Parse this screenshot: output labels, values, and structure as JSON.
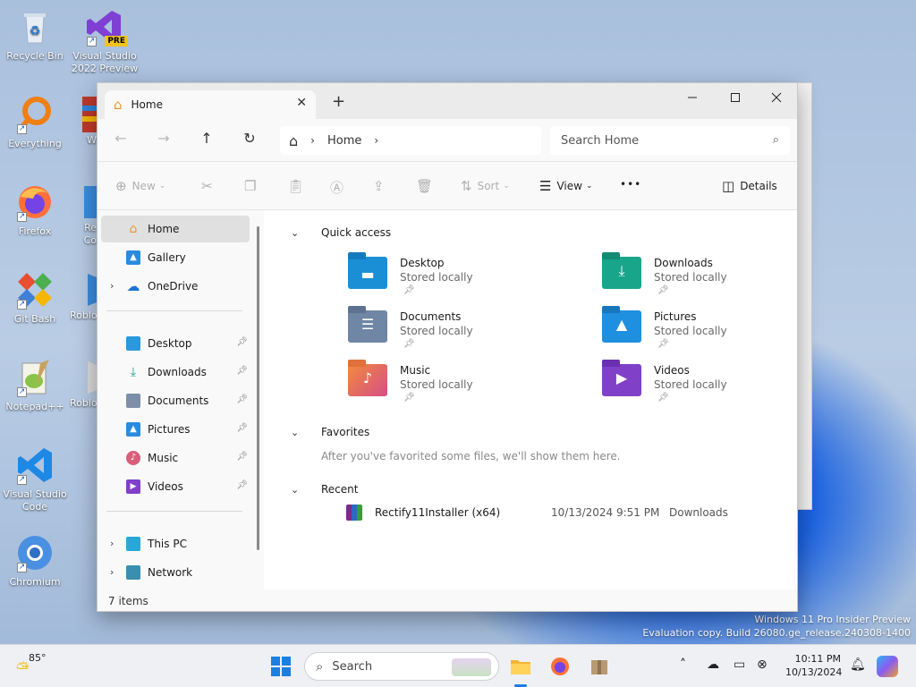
{
  "desktop": {
    "icons": [
      {
        "label": "Recycle Bin"
      },
      {
        "label": "Visual Studio 2022 Preview",
        "badge": "PRE"
      },
      {
        "label": "Everything"
      },
      {
        "label": "W"
      },
      {
        "label": "Firefox"
      },
      {
        "label": "Re Co"
      },
      {
        "label": "Git Bash"
      },
      {
        "label": "Roblo"
      },
      {
        "label": "Notepad++"
      },
      {
        "label": "Roblo"
      },
      {
        "label": "Visual Studio Code"
      },
      {
        "label": "Chromium"
      }
    ],
    "watermark": {
      "line1": "Windows 11 Pro Insider Preview",
      "line2": "Evaluation copy. Build 26080.ge_release.240308-1400"
    }
  },
  "explorer": {
    "tab_label": "Home",
    "new_tab_symbol": "+",
    "address_crumb": "Home",
    "search_placeholder": "Search Home",
    "command_bar": {
      "new": "New",
      "sort": "Sort",
      "view": "View",
      "more": "•••",
      "details": "Details"
    },
    "sidebar": {
      "top": [
        {
          "label": "Home",
          "icon": "home-icon"
        },
        {
          "label": "Gallery",
          "icon": "gallery-icon"
        },
        {
          "label": "OneDrive",
          "icon": "cloud-icon"
        }
      ],
      "pinned": [
        {
          "label": "Desktop",
          "icon": "desktop-folder-icon"
        },
        {
          "label": "Downloads",
          "icon": "download-icon"
        },
        {
          "label": "Documents",
          "icon": "document-icon"
        },
        {
          "label": "Pictures",
          "icon": "pictures-icon"
        },
        {
          "label": "Music",
          "icon": "music-icon"
        },
        {
          "label": "Videos",
          "icon": "video-icon"
        }
      ],
      "bottom": [
        {
          "label": "This PC",
          "icon": "computer-icon"
        },
        {
          "label": "Network",
          "icon": "network-icon"
        }
      ]
    },
    "quick_access": {
      "header": "Quick access",
      "items": [
        {
          "name": "Desktop",
          "sub": "Stored locally",
          "color": "#1a8fd6"
        },
        {
          "name": "Downloads",
          "sub": "Stored locally",
          "color": "#18a58a"
        },
        {
          "name": "Documents",
          "sub": "Stored locally",
          "color": "#6f86a4"
        },
        {
          "name": "Pictures",
          "sub": "Stored locally",
          "color": "#1f8fe0"
        },
        {
          "name": "Music",
          "sub": "Stored locally",
          "color": "#e0576a"
        },
        {
          "name": "Videos",
          "sub": "Stored locally",
          "color": "#8040c8"
        }
      ]
    },
    "favorites": {
      "header": "Favorites",
      "empty_text": "After you've favorited some files, we'll show them here."
    },
    "recent": {
      "header": "Recent",
      "items": [
        {
          "name": "Rectify11Installer (x64)",
          "date": "10/13/2024 9:51 PM",
          "location": "Downloads"
        }
      ]
    },
    "status": "7 items"
  },
  "taskbar": {
    "weather_temp": "85°",
    "search_label": "Search",
    "time": "10:11 PM",
    "date": "10/13/2024"
  }
}
